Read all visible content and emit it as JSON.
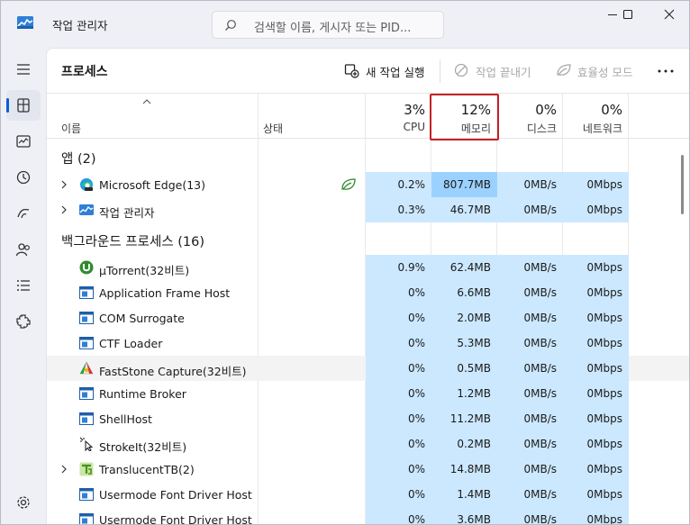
{
  "window": {
    "title": "작업 관리자",
    "search_placeholder": "검색할 이름, 게시자 또는 PID..."
  },
  "toolbar": {
    "page_title": "프로세스",
    "new_task_label": "새 작업 실행",
    "end_task_label": "작업 끝내기",
    "efficiency_label": "효율성 모드"
  },
  "columns": {
    "name": "이름",
    "status": "상태",
    "cpu": {
      "pct": "3%",
      "label": "CPU"
    },
    "memory": {
      "pct": "12%",
      "label": "메모리"
    },
    "disk": {
      "pct": "0%",
      "label": "디스크"
    },
    "network": {
      "pct": "0%",
      "label": "네트워크"
    }
  },
  "groups": {
    "apps": "앱 (2)",
    "background": "백그라운드 프로세스 (16)"
  },
  "apps": [
    {
      "name": "Microsoft Edge(13)",
      "icon": "edge-icon",
      "expand": true,
      "eco": true,
      "cpu": "0.2%",
      "mem": "807.7MB",
      "mem_hot": true,
      "disk": "0MB/s",
      "net": "0Mbps"
    },
    {
      "name": "작업 관리자",
      "icon": "task-manager-icon",
      "expand": true,
      "eco": false,
      "cpu": "0.3%",
      "mem": "46.7MB",
      "mem_hot": false,
      "disk": "0MB/s",
      "net": "0Mbps"
    }
  ],
  "background": [
    {
      "name": "µTorrent(32비트)",
      "icon": "utorrent-icon",
      "expand": false,
      "cpu": "0.9%",
      "mem": "62.4MB",
      "disk": "0MB/s",
      "net": "0Mbps"
    },
    {
      "name": "Application Frame Host",
      "icon": "window-icon",
      "expand": false,
      "cpu": "0%",
      "mem": "6.6MB",
      "disk": "0MB/s",
      "net": "0Mbps"
    },
    {
      "name": "COM Surrogate",
      "icon": "window-icon",
      "expand": false,
      "cpu": "0%",
      "mem": "2.0MB",
      "disk": "0MB/s",
      "net": "0Mbps"
    },
    {
      "name": "CTF Loader",
      "icon": "window-icon",
      "expand": false,
      "cpu": "0%",
      "mem": "5.3MB",
      "disk": "0MB/s",
      "net": "0Mbps"
    },
    {
      "name": "FastStone Capture(32비트)",
      "icon": "faststone-icon",
      "expand": false,
      "hover": true,
      "cpu": "0%",
      "mem": "0.5MB",
      "disk": "0MB/s",
      "net": "0Mbps"
    },
    {
      "name": "Runtime Broker",
      "icon": "window-icon",
      "expand": false,
      "cpu": "0%",
      "mem": "1.2MB",
      "disk": "0MB/s",
      "net": "0Mbps"
    },
    {
      "name": "ShellHost",
      "icon": "window-icon",
      "expand": false,
      "cpu": "0%",
      "mem": "11.2MB",
      "disk": "0MB/s",
      "net": "0Mbps"
    },
    {
      "name": "StrokeIt(32비트)",
      "icon": "strokeit-icon",
      "expand": false,
      "cpu": "0%",
      "mem": "0.2MB",
      "disk": "0MB/s",
      "net": "0Mbps"
    },
    {
      "name": "TranslucentTB(2)",
      "icon": "translucenttb-icon",
      "expand": true,
      "cpu": "0%",
      "mem": "14.8MB",
      "disk": "0MB/s",
      "net": "0Mbps"
    },
    {
      "name": "Usermode Font Driver Host",
      "icon": "window-icon",
      "expand": false,
      "cpu": "0%",
      "mem": "1.4MB",
      "disk": "0MB/s",
      "net": "0Mbps"
    },
    {
      "name": "Usermode Font Driver Host",
      "icon": "window-icon",
      "expand": false,
      "cpu": "0%",
      "mem": "3.6MB",
      "disk": "0MB/s",
      "net": "0Mbps"
    }
  ],
  "colors": {
    "accent": "#0b5cd5",
    "heat": "#cce8ff",
    "heat_high": "#9bd1ff",
    "highlight_box": "#c62026"
  }
}
